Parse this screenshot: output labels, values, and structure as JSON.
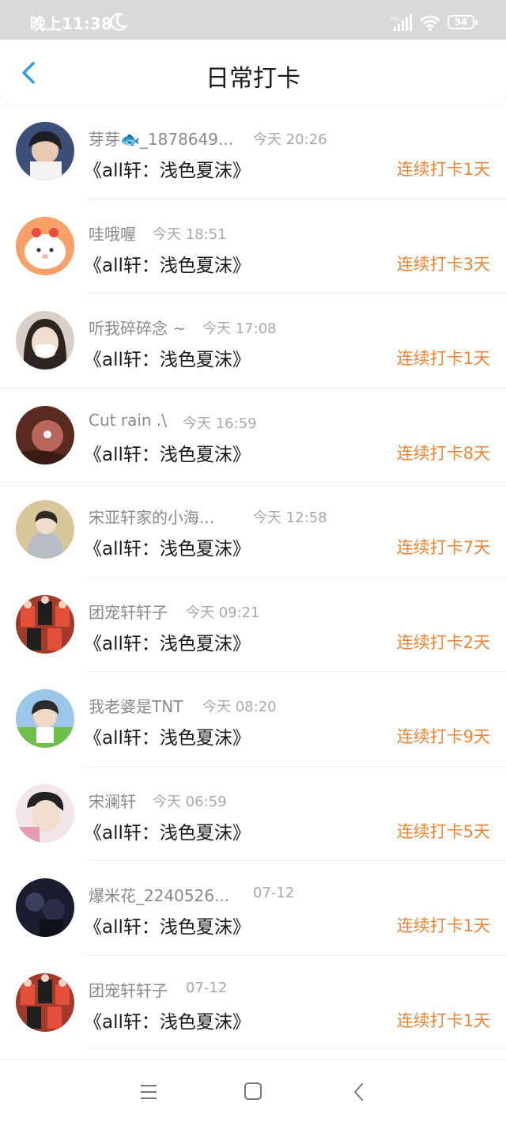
{
  "status_bar": {
    "time": "晚上11:38",
    "battery": "34"
  },
  "header": {
    "title": "日常打卡"
  },
  "checkins": [
    {
      "username": "芽芽🐟_1878649...",
      "time": "今天 20:26",
      "book": "《all轩：浅色夏沫》",
      "streak": "连续打卡1天"
    },
    {
      "username": "哇哦喔",
      "time": "今天 18:51",
      "book": "《all轩：浅色夏沫》",
      "streak": "连续打卡3天"
    },
    {
      "username": "听我碎碎念 ~",
      "time": "今天 17:08",
      "book": "《all轩：浅色夏沫》",
      "streak": "连续打卡1天"
    },
    {
      "username": "Cut rain .\\",
      "time": "今天 16:59",
      "book": "《all轩：浅色夏沫》",
      "streak": "连续打卡8天"
    },
    {
      "username": "宋亚轩家的小海...",
      "time": "今天 12:58",
      "book": "《all轩：浅色夏沫》",
      "streak": "连续打卡7天"
    },
    {
      "username": "团宠轩轩子",
      "time": "今天 09:21",
      "book": "《all轩：浅色夏沫》",
      "streak": "连续打卡2天"
    },
    {
      "username": "我老婆是TNT",
      "time": "今天 08:20",
      "book": "《all轩：浅色夏沫》",
      "streak": "连续打卡9天"
    },
    {
      "username": "宋澜轩",
      "time": "今天 06:59",
      "book": "《all轩：浅色夏沫》",
      "streak": "连续打卡5天"
    },
    {
      "username": "爆米花_2240526...",
      "time": "07-12",
      "book": "《all轩：浅色夏沫》",
      "streak": "连续打卡1天"
    },
    {
      "username": "团宠轩轩子",
      "time": "07-12",
      "book": "《all轩：浅色夏沫》",
      "streak": "连续打卡1天"
    }
  ],
  "colors": {
    "accent": "#f08536",
    "back_arrow": "#2f9be8",
    "status_bar_bg": "#d9d9d9"
  },
  "icons": {
    "back": "chevron-left-icon",
    "menu": "menu-icon",
    "home": "home-icon",
    "system_back": "back-icon"
  }
}
